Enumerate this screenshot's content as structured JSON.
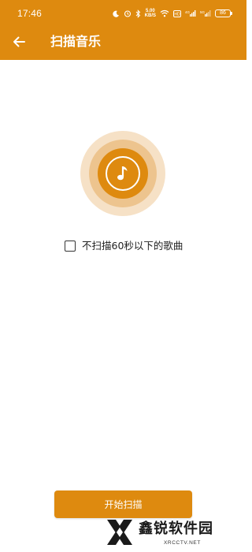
{
  "status_bar": {
    "time": "17:46",
    "net_speed_value": "5.00",
    "net_speed_unit": "KB/S",
    "network_1": "4G",
    "network_2": "5G",
    "battery": "86"
  },
  "header": {
    "back_icon": "arrow-left-icon",
    "title": "扫描音乐"
  },
  "scan_graphic": {
    "icon": "music-note-icon"
  },
  "option": {
    "checked": false,
    "label": "不扫描60秒以下的歌曲"
  },
  "actions": {
    "start_label": "开始扫描"
  },
  "watermark": {
    "brand": "鑫锐软件园",
    "url": "XRCCTV.NET"
  },
  "colors": {
    "accent": "#DE8A0F",
    "ring_outer": "#F6E1C6",
    "ring_mid": "#EDC48E"
  }
}
